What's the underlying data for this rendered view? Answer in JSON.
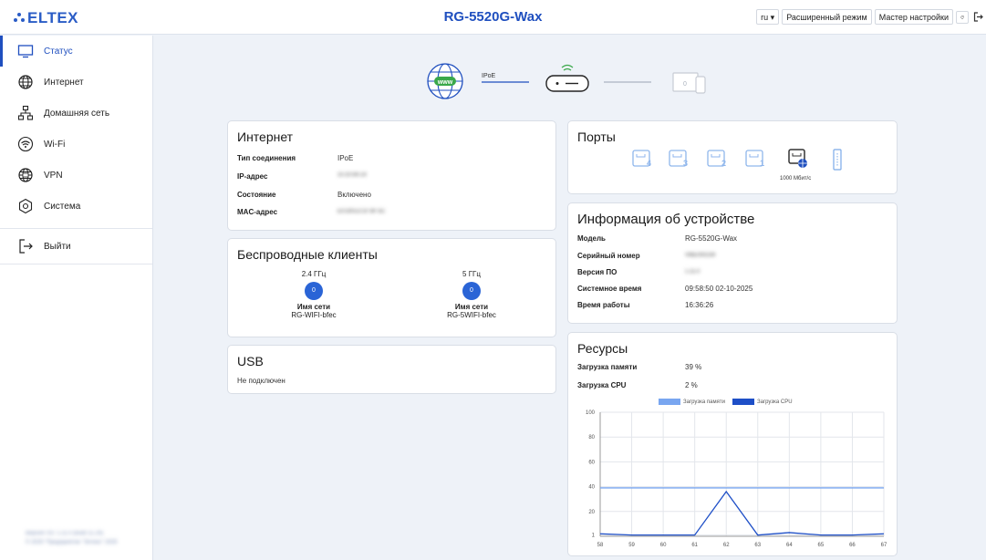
{
  "header": {
    "logo_text": "eltex",
    "title": "RG-5520G-Wax",
    "lang": "ru ▾",
    "advanced_mode": "Расширенный режим",
    "setup_wizard": "Мастер настройки"
  },
  "sidebar": {
    "items": [
      {
        "label": "Статус",
        "icon": "monitor-icon",
        "active": true
      },
      {
        "label": "Интернет",
        "icon": "globe-icon"
      },
      {
        "label": "Домашняя сеть",
        "icon": "network-icon"
      },
      {
        "label": "Wi-Fi",
        "icon": "wifi-icon"
      },
      {
        "label": "VPN",
        "icon": "vpn-globe-icon"
      },
      {
        "label": "Система",
        "icon": "gear-icon"
      }
    ],
    "logout": "Выйти",
    "footer_line1": "Версия ПО: 1.11.0 (build 11.29)",
    "footer_line2": "© 2025 \"Предприятие \"Элтекс\" 2025"
  },
  "topology": {
    "link_label": "IPoE",
    "www_label": "www",
    "devices_count": "0"
  },
  "internet": {
    "title": "Интернет",
    "rows": [
      {
        "key": "Тип соединения",
        "value": "IPoE",
        "blurred": false
      },
      {
        "key": "IP-адрес",
        "value": "10.20.64.14",
        "blurred": true
      },
      {
        "key": "Состояние",
        "value": "Включено",
        "blurred": false
      },
      {
        "key": "MAC-адрес",
        "value": "E0:D9:E3:1F:8F:5C",
        "blurred": true
      }
    ]
  },
  "wireless": {
    "title": "Беспроводные клиенты",
    "bands": [
      {
        "band": "2.4 ГГц",
        "count": "0",
        "ssid_label": "Имя сети",
        "ssid": "RG-WIFI-bfec"
      },
      {
        "band": "5 ГГц",
        "count": "0",
        "ssid_label": "Имя сети",
        "ssid": "RG-5WIFI-bfec"
      }
    ]
  },
  "usb": {
    "title": "USB",
    "status": "Не подключен"
  },
  "ports": {
    "title": "Порты",
    "lan": [
      "4",
      "3",
      "2",
      "1"
    ],
    "wan_speed": "1000 Мбит/с"
  },
  "device": {
    "title": "Информация об устройстве",
    "rows": [
      {
        "key": "Модель",
        "value": "RG-5520G-Wax",
        "blurred": false
      },
      {
        "key": "Серийный номер",
        "value": "VI8E000239",
        "blurred": true
      },
      {
        "key": "Версия ПО",
        "value": "1.11.0",
        "blurred": true
      },
      {
        "key": "Системное время",
        "value": "09:58:50 02-10-2025",
        "blurred": false
      },
      {
        "key": "Время работы",
        "value": "16:36:26",
        "blurred": false
      }
    ]
  },
  "resources": {
    "title": "Ресурсы",
    "rows": [
      {
        "key": "Загрузка памяти",
        "value": "39 %"
      },
      {
        "key": "Загрузка CPU",
        "value": "2 %"
      }
    ]
  },
  "colors": {
    "accent": "#1f4fbf",
    "memory_series": "#79a6f0",
    "cpu_series": "#1e4fc7"
  },
  "chart_data": {
    "type": "line",
    "x": [
      58,
      59,
      60,
      61,
      62,
      63,
      64,
      65,
      66,
      67
    ],
    "series": [
      {
        "name": "Загрузка памяти",
        "values": [
          39,
          39,
          39,
          39,
          39,
          39,
          39,
          39,
          39,
          39
        ]
      },
      {
        "name": "Загрузка CPU",
        "values": [
          2,
          1,
          1,
          1,
          36,
          1,
          3,
          1,
          1,
          2
        ]
      }
    ],
    "yticks": [
      1,
      20,
      40,
      60,
      80,
      100
    ],
    "ylim": [
      0,
      100
    ],
    "grid": true,
    "legend": "top"
  }
}
